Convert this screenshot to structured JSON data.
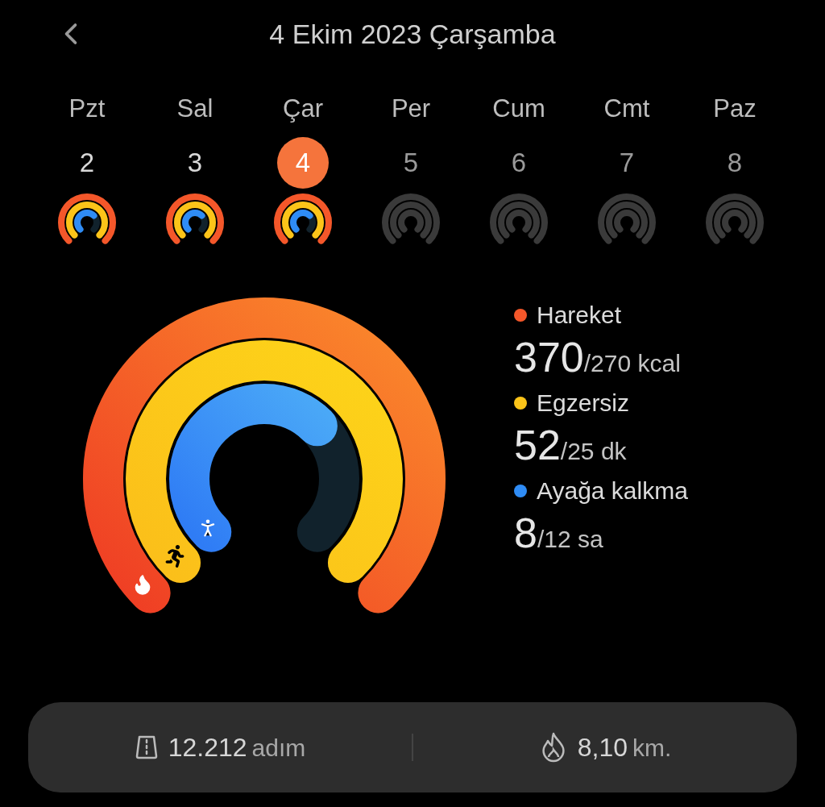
{
  "header": {
    "title": "4 Ekim 2023 Çarşamba"
  },
  "days": [
    {
      "name": "Pzt",
      "number": "2",
      "selected": false,
      "active": true
    },
    {
      "name": "Sal",
      "number": "3",
      "selected": false,
      "active": true
    },
    {
      "name": "Çar",
      "number": "4",
      "selected": true,
      "active": true
    },
    {
      "name": "Per",
      "number": "5",
      "selected": false,
      "active": false
    },
    {
      "name": "Cum",
      "number": "6",
      "selected": false,
      "active": false
    },
    {
      "name": "Cmt",
      "number": "7",
      "selected": false,
      "active": false
    },
    {
      "name": "Paz",
      "number": "8",
      "selected": false,
      "active": false
    }
  ],
  "metrics": [
    {
      "kind": "move",
      "label": "Hareket",
      "value": "370",
      "goal": "/270 kcal",
      "color": "#f4572a"
    },
    {
      "kind": "exercise",
      "label": "Egzersiz",
      "value": "52",
      "goal": "/25 dk",
      "color": "#fcc419"
    },
    {
      "kind": "stand",
      "label": "Ayağa kalkma",
      "value": "8",
      "goal": "/12 sa",
      "color": "#2f8cf5"
    }
  ],
  "summary": [
    {
      "kind": "steps",
      "value": "12.212",
      "unit": "adım"
    },
    {
      "kind": "distance",
      "value": "8,10",
      "unit": "km."
    }
  ]
}
